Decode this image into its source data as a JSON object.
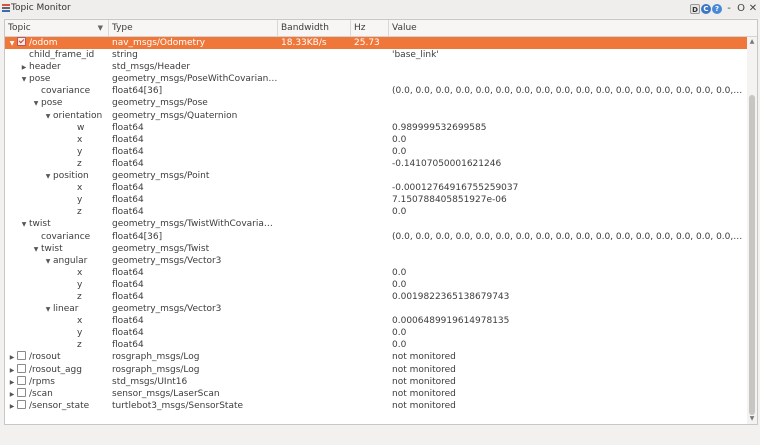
{
  "window": {
    "title": "Topic Monitor",
    "buttons": {
      "d": "D",
      "r": "C",
      "help": "?",
      "minimize": "-",
      "restore": "O",
      "close": "✕"
    }
  },
  "columns": {
    "topic": "Topic",
    "type": "Type",
    "bandwidth": "Bandwidth",
    "hz": "Hz",
    "value": "Value"
  },
  "rows": [
    {
      "level": 0,
      "exp": "down",
      "checkbox": true,
      "checked": true,
      "selected": true,
      "topic": "/odom",
      "type": "nav_msgs/Odometry",
      "bandwidth": "18.33KB/s",
      "hz": "25.73",
      "value": ""
    },
    {
      "level": 1,
      "exp": "none",
      "topic": "child_frame_id",
      "type": "string",
      "value": "'base_link'"
    },
    {
      "level": 1,
      "exp": "right",
      "topic": "header",
      "type": "std_msgs/Header",
      "value": ""
    },
    {
      "level": 1,
      "exp": "down",
      "topic": "pose",
      "type": "geometry_msgs/PoseWithCovariance",
      "value": ""
    },
    {
      "level": 2,
      "exp": "none",
      "topic": "covariance",
      "type": "float64[36]",
      "value": "(0.0, 0.0, 0.0, 0.0, 0.0, 0.0, 0.0, 0.0, 0.0, 0.0, 0.0, 0.0, 0.0, 0.0, 0.0, 0.0, 0.0, 0.0, 0.0, …"
    },
    {
      "level": 2,
      "exp": "down",
      "topic": "pose",
      "type": "geometry_msgs/Pose",
      "value": ""
    },
    {
      "level": 3,
      "exp": "down",
      "topic": "orientation",
      "type": "geometry_msgs/Quaternion",
      "value": ""
    },
    {
      "level": 5,
      "exp": "none",
      "topic": "w",
      "type": "float64",
      "value": "0.989999532699585"
    },
    {
      "level": 5,
      "exp": "none",
      "topic": "x",
      "type": "float64",
      "value": "0.0"
    },
    {
      "level": 5,
      "exp": "none",
      "topic": "y",
      "type": "float64",
      "value": "0.0"
    },
    {
      "level": 5,
      "exp": "none",
      "topic": "z",
      "type": "float64",
      "value": "-0.14107050001621246"
    },
    {
      "level": 3,
      "exp": "down",
      "topic": "position",
      "type": "geometry_msgs/Point",
      "value": ""
    },
    {
      "level": 5,
      "exp": "none",
      "topic": "x",
      "type": "float64",
      "value": "-0.00012764916755259037"
    },
    {
      "level": 5,
      "exp": "none",
      "topic": "y",
      "type": "float64",
      "value": "7.150788405851927e-06"
    },
    {
      "level": 5,
      "exp": "none",
      "topic": "z",
      "type": "float64",
      "value": "0.0"
    },
    {
      "level": 1,
      "exp": "down",
      "topic": "twist",
      "type": "geometry_msgs/TwistWithCovariance",
      "value": ""
    },
    {
      "level": 2,
      "exp": "none",
      "topic": "covariance",
      "type": "float64[36]",
      "value": "(0.0, 0.0, 0.0, 0.0, 0.0, 0.0, 0.0, 0.0, 0.0, 0.0, 0.0, 0.0, 0.0, 0.0, 0.0, 0.0, 0.0, 0.0, 0.0, …"
    },
    {
      "level": 2,
      "exp": "down",
      "topic": "twist",
      "type": "geometry_msgs/Twist",
      "value": ""
    },
    {
      "level": 3,
      "exp": "down",
      "topic": "angular",
      "type": "geometry_msgs/Vector3",
      "value": ""
    },
    {
      "level": 5,
      "exp": "none",
      "topic": "x",
      "type": "float64",
      "value": "0.0"
    },
    {
      "level": 5,
      "exp": "none",
      "topic": "y",
      "type": "float64",
      "value": "0.0"
    },
    {
      "level": 5,
      "exp": "none",
      "topic": "z",
      "type": "float64",
      "value": "0.0019822365138679743"
    },
    {
      "level": 3,
      "exp": "down",
      "topic": "linear",
      "type": "geometry_msgs/Vector3",
      "value": ""
    },
    {
      "level": 5,
      "exp": "none",
      "topic": "x",
      "type": "float64",
      "value": "0.0006489919614978135"
    },
    {
      "level": 5,
      "exp": "none",
      "topic": "y",
      "type": "float64",
      "value": "0.0"
    },
    {
      "level": 5,
      "exp": "none",
      "topic": "z",
      "type": "float64",
      "value": "0.0"
    },
    {
      "level": 0,
      "exp": "right",
      "checkbox": true,
      "checked": false,
      "topic": "/rosout",
      "type": "rosgraph_msgs/Log",
      "value": "not monitored"
    },
    {
      "level": 0,
      "exp": "right",
      "checkbox": true,
      "checked": false,
      "topic": "/rosout_agg",
      "type": "rosgraph_msgs/Log",
      "value": "not monitored"
    },
    {
      "level": 0,
      "exp": "right",
      "checkbox": true,
      "checked": false,
      "topic": "/rpms",
      "type": "std_msgs/UInt16",
      "value": "not monitored"
    },
    {
      "level": 0,
      "exp": "right",
      "checkbox": true,
      "checked": false,
      "topic": "/scan",
      "type": "sensor_msgs/LaserScan",
      "value": "not monitored"
    },
    {
      "level": 0,
      "exp": "right",
      "checkbox": true,
      "checked": false,
      "topic": "/sensor_state",
      "type": "turtlebot3_msgs/SensorState",
      "value": "not monitored"
    }
  ],
  "colors": {
    "selection": "#f0773a",
    "background": "#ffffff",
    "chrome": "#f2f1f0"
  }
}
